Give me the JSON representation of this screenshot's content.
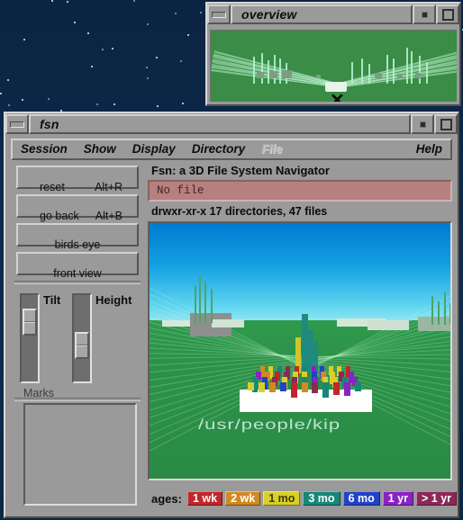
{
  "desktop": {
    "background_color": "#0c2541",
    "star_color": "#9fc2dd"
  },
  "overview_window": {
    "title": "overview",
    "minimize_icon": "minimize-icon",
    "menu_icon": "window-menu-icon",
    "maximize_icon": "maximize-icon",
    "scene_background": "#3a8c46"
  },
  "fsn_window": {
    "title": "fsn",
    "minimize_icon": "minimize-icon",
    "menu_icon": "window-menu-icon",
    "maximize_icon": "maximize-icon",
    "menubar": [
      {
        "label": "Session",
        "disabled": false
      },
      {
        "label": "Show",
        "disabled": false
      },
      {
        "label": "Display",
        "disabled": false
      },
      {
        "label": "Directory",
        "disabled": false
      },
      {
        "label": "File",
        "disabled": true
      }
    ],
    "help_label": "Help",
    "buttons": [
      {
        "label": "reset",
        "accel": "Alt+R",
        "centered": false
      },
      {
        "label": "go back",
        "accel": "Alt+B",
        "centered": false
      },
      {
        "label": "birds eye",
        "accel": "",
        "centered": true
      },
      {
        "label": "front view",
        "accel": "",
        "centered": true
      }
    ],
    "sliders": [
      {
        "label": "Tilt",
        "thumb_pct": 22
      },
      {
        "label": "Height",
        "thumb_pct": 62
      }
    ],
    "marks": {
      "title": "Marks",
      "items": []
    },
    "info": {
      "headline": "Fsn:  a 3D File System Navigator",
      "file_status": "No file",
      "file_status_bg": "#b58080",
      "dir_stats": "drwxr-xr-x 17 directories, 47 files"
    },
    "viewport": {
      "path_label": "/usr/people/kip",
      "sky_top_color": "#0079d0",
      "sky_bottom_color": "#8fe4f2",
      "ground_color": "#2d9249"
    },
    "ages": {
      "label": "ages:",
      "chips": [
        {
          "label": "1 wk",
          "bg": "#c0262b",
          "fg": "#ffffff"
        },
        {
          "label": "2 wk",
          "bg": "#d08a22",
          "fg": "#ffffff"
        },
        {
          "label": "1 mo",
          "bg": "#d8cf2a",
          "fg": "#3a3a00"
        },
        {
          "label": "3 mo",
          "bg": "#188778",
          "fg": "#ffffff"
        },
        {
          "label": "6 mo",
          "bg": "#2242c8",
          "fg": "#ffffff"
        },
        {
          "label": "1 yr",
          "bg": "#8b22c4",
          "fg": "#ffffff"
        },
        {
          "label": "> 1 yr",
          "bg": "#8c2858",
          "fg": "#ffffff"
        }
      ]
    }
  }
}
